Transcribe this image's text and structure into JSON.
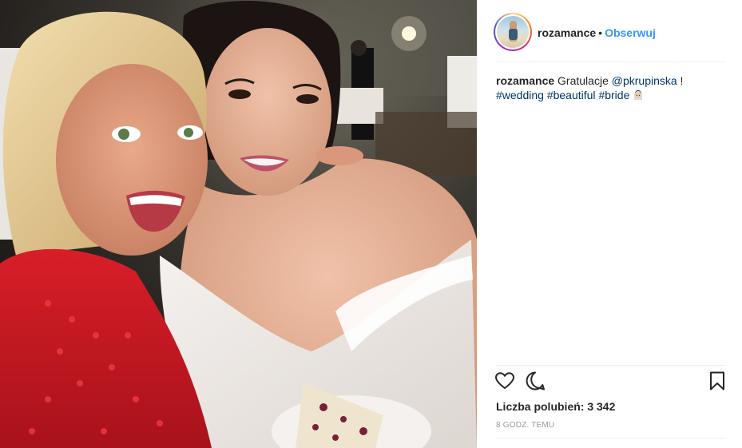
{
  "post": {
    "username": "rozamance",
    "separator": "•",
    "follow_label": "Obserwuj",
    "caption": {
      "username": "rozamance",
      "text": " Gratulacje ",
      "mention": "@pkrupinska",
      "after_mention": " !",
      "hashtags": [
        "#wedding",
        "#beautiful",
        "#bride"
      ],
      "emoji": "bride-emoji"
    },
    "likes_label": "Liczba polubień: 3 342",
    "timestamp": "8 GODZ. TEMU"
  },
  "icons": {
    "like": "heart-outline-icon",
    "comment": "comment-bubble-icon",
    "save": "bookmark-icon"
  },
  "colors": {
    "link_blue": "#3897f0",
    "hashtag_blue": "#003569",
    "text": "#262626",
    "muted": "#999999",
    "border": "#efefef"
  }
}
